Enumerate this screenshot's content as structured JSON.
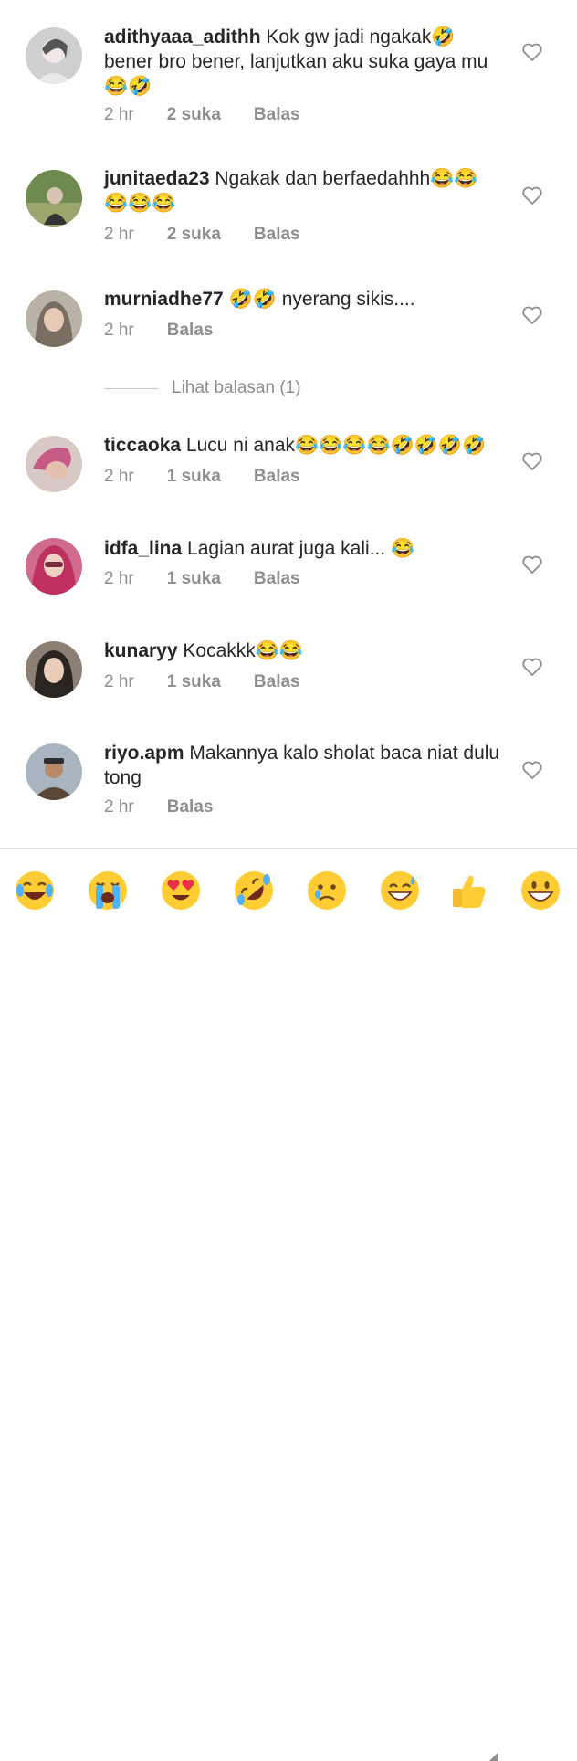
{
  "comments": [
    {
      "user": "adithyaaa_adithh",
      "text": "Kok gw jadi ngakak🤣 bener bro bener, lanjutkan aku suka gaya mu 😂🤣",
      "time": "2 hr",
      "likes": "2 suka",
      "reply": "Balas"
    },
    {
      "user": "junitaeda23",
      "text": "Ngakak dan berfaedahhh😂😂 😂😂😂",
      "time": "2 hr",
      "likes": "2 suka",
      "reply": "Balas"
    },
    {
      "user": "murniadhe77",
      "text": "🤣🤣 nyerang sikis....",
      "time": "2 hr",
      "likes": "",
      "reply": "Balas"
    },
    {
      "user": "ticcaoka",
      "text": "Lucu ni anak😂😂😂😂🤣🤣🤣🤣",
      "time": "2 hr",
      "likes": "1 suka",
      "reply": "Balas"
    },
    {
      "user": "idfa_lina",
      "text": "Lagian aurat juga kali... 😂",
      "time": "2 hr",
      "likes": "1 suka",
      "reply": "Balas"
    },
    {
      "user": "kunaryy",
      "text": "Kocakkk😂😂",
      "time": "2 hr",
      "likes": "1 suka",
      "reply": "Balas"
    },
    {
      "user": "riyo.apm",
      "text": "Makannya kalo sholat baca niat dulu tong",
      "time": "2 hr",
      "likes": "",
      "reply": "Balas"
    }
  ],
  "view_replies": "Lihat balasan (1)",
  "emoji_bar": [
    "face-with-tears-of-joy",
    "loudly-crying-face",
    "heart-eyes-face",
    "rolling-on-floor-laughing",
    "crying-face",
    "grinning-sweat-face",
    "thumbs-up",
    "grinning-face"
  ],
  "colors": {
    "username": "#262626",
    "meta": "#8e8e8e",
    "divider": "#dbdbdb",
    "emoji_yellow": "#ffcc33"
  }
}
